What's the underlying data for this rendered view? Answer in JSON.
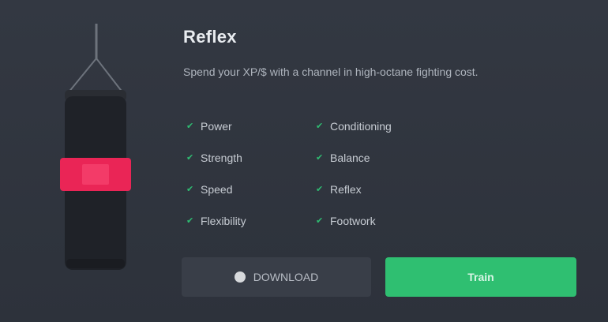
{
  "product": {
    "title": "Reflex",
    "description": "Spend your XP/$ with a channel in high-octane fighting cost.",
    "image_icon": "punching-bag"
  },
  "features": {
    "items": [
      {
        "label": "Power",
        "icon": "check"
      },
      {
        "label": "Conditioning",
        "icon": "check"
      },
      {
        "label": "Strength",
        "icon": "check"
      },
      {
        "label": "Balance",
        "icon": "check"
      },
      {
        "label": "Speed",
        "icon": "check"
      },
      {
        "label": "Reflex",
        "icon": "check"
      },
      {
        "label": "Flexibility",
        "icon": "check"
      },
      {
        "label": "Footwork",
        "icon": "check"
      }
    ]
  },
  "actions": {
    "secondary_label": "DOWNLOAD",
    "primary_label": "Train"
  },
  "colors": {
    "background": "#2f343d",
    "accent_green": "#2fbf71",
    "bag_band": "#ea2556",
    "bag_body": "#1f2228"
  }
}
